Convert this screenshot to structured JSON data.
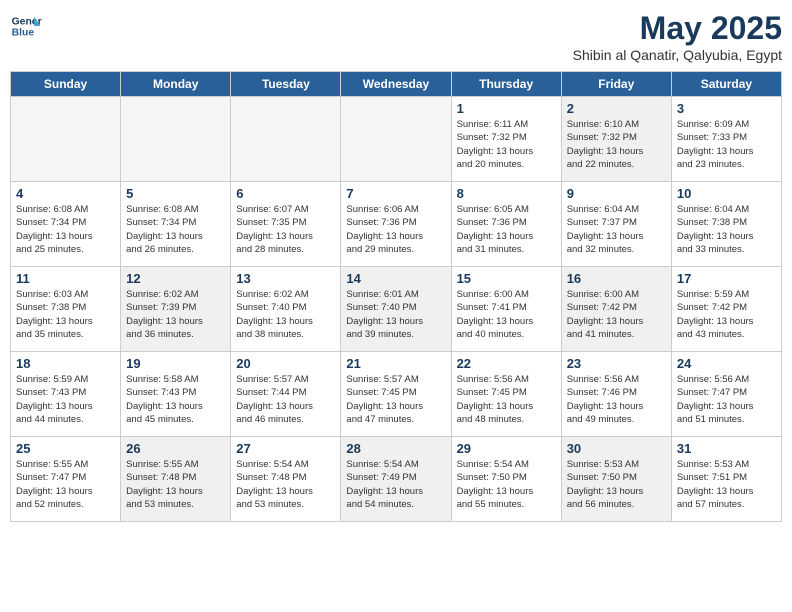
{
  "header": {
    "logo_line1": "General",
    "logo_line2": "Blue",
    "title": "May 2025",
    "subtitle": "Shibin al Qanatir, Qalyubia, Egypt"
  },
  "days_of_week": [
    "Sunday",
    "Monday",
    "Tuesday",
    "Wednesday",
    "Thursday",
    "Friday",
    "Saturday"
  ],
  "weeks": [
    [
      {
        "day": "",
        "info": "",
        "empty": true
      },
      {
        "day": "",
        "info": "",
        "empty": true
      },
      {
        "day": "",
        "info": "",
        "empty": true
      },
      {
        "day": "",
        "info": "",
        "empty": true
      },
      {
        "day": "1",
        "info": "Sunrise: 6:11 AM\nSunset: 7:32 PM\nDaylight: 13 hours\nand 20 minutes."
      },
      {
        "day": "2",
        "info": "Sunrise: 6:10 AM\nSunset: 7:32 PM\nDaylight: 13 hours\nand 22 minutes."
      },
      {
        "day": "3",
        "info": "Sunrise: 6:09 AM\nSunset: 7:33 PM\nDaylight: 13 hours\nand 23 minutes."
      }
    ],
    [
      {
        "day": "4",
        "info": "Sunrise: 6:08 AM\nSunset: 7:34 PM\nDaylight: 13 hours\nand 25 minutes."
      },
      {
        "day": "5",
        "info": "Sunrise: 6:08 AM\nSunset: 7:34 PM\nDaylight: 13 hours\nand 26 minutes."
      },
      {
        "day": "6",
        "info": "Sunrise: 6:07 AM\nSunset: 7:35 PM\nDaylight: 13 hours\nand 28 minutes."
      },
      {
        "day": "7",
        "info": "Sunrise: 6:06 AM\nSunset: 7:36 PM\nDaylight: 13 hours\nand 29 minutes."
      },
      {
        "day": "8",
        "info": "Sunrise: 6:05 AM\nSunset: 7:36 PM\nDaylight: 13 hours\nand 31 minutes."
      },
      {
        "day": "9",
        "info": "Sunrise: 6:04 AM\nSunset: 7:37 PM\nDaylight: 13 hours\nand 32 minutes."
      },
      {
        "day": "10",
        "info": "Sunrise: 6:04 AM\nSunset: 7:38 PM\nDaylight: 13 hours\nand 33 minutes."
      }
    ],
    [
      {
        "day": "11",
        "info": "Sunrise: 6:03 AM\nSunset: 7:38 PM\nDaylight: 13 hours\nand 35 minutes."
      },
      {
        "day": "12",
        "info": "Sunrise: 6:02 AM\nSunset: 7:39 PM\nDaylight: 13 hours\nand 36 minutes."
      },
      {
        "day": "13",
        "info": "Sunrise: 6:02 AM\nSunset: 7:40 PM\nDaylight: 13 hours\nand 38 minutes."
      },
      {
        "day": "14",
        "info": "Sunrise: 6:01 AM\nSunset: 7:40 PM\nDaylight: 13 hours\nand 39 minutes."
      },
      {
        "day": "15",
        "info": "Sunrise: 6:00 AM\nSunset: 7:41 PM\nDaylight: 13 hours\nand 40 minutes."
      },
      {
        "day": "16",
        "info": "Sunrise: 6:00 AM\nSunset: 7:42 PM\nDaylight: 13 hours\nand 41 minutes."
      },
      {
        "day": "17",
        "info": "Sunrise: 5:59 AM\nSunset: 7:42 PM\nDaylight: 13 hours\nand 43 minutes."
      }
    ],
    [
      {
        "day": "18",
        "info": "Sunrise: 5:59 AM\nSunset: 7:43 PM\nDaylight: 13 hours\nand 44 minutes."
      },
      {
        "day": "19",
        "info": "Sunrise: 5:58 AM\nSunset: 7:43 PM\nDaylight: 13 hours\nand 45 minutes."
      },
      {
        "day": "20",
        "info": "Sunrise: 5:57 AM\nSunset: 7:44 PM\nDaylight: 13 hours\nand 46 minutes."
      },
      {
        "day": "21",
        "info": "Sunrise: 5:57 AM\nSunset: 7:45 PM\nDaylight: 13 hours\nand 47 minutes."
      },
      {
        "day": "22",
        "info": "Sunrise: 5:56 AM\nSunset: 7:45 PM\nDaylight: 13 hours\nand 48 minutes."
      },
      {
        "day": "23",
        "info": "Sunrise: 5:56 AM\nSunset: 7:46 PM\nDaylight: 13 hours\nand 49 minutes."
      },
      {
        "day": "24",
        "info": "Sunrise: 5:56 AM\nSunset: 7:47 PM\nDaylight: 13 hours\nand 51 minutes."
      }
    ],
    [
      {
        "day": "25",
        "info": "Sunrise: 5:55 AM\nSunset: 7:47 PM\nDaylight: 13 hours\nand 52 minutes."
      },
      {
        "day": "26",
        "info": "Sunrise: 5:55 AM\nSunset: 7:48 PM\nDaylight: 13 hours\nand 53 minutes."
      },
      {
        "day": "27",
        "info": "Sunrise: 5:54 AM\nSunset: 7:48 PM\nDaylight: 13 hours\nand 53 minutes."
      },
      {
        "day": "28",
        "info": "Sunrise: 5:54 AM\nSunset: 7:49 PM\nDaylight: 13 hours\nand 54 minutes."
      },
      {
        "day": "29",
        "info": "Sunrise: 5:54 AM\nSunset: 7:50 PM\nDaylight: 13 hours\nand 55 minutes."
      },
      {
        "day": "30",
        "info": "Sunrise: 5:53 AM\nSunset: 7:50 PM\nDaylight: 13 hours\nand 56 minutes."
      },
      {
        "day": "31",
        "info": "Sunrise: 5:53 AM\nSunset: 7:51 PM\nDaylight: 13 hours\nand 57 minutes."
      }
    ]
  ]
}
